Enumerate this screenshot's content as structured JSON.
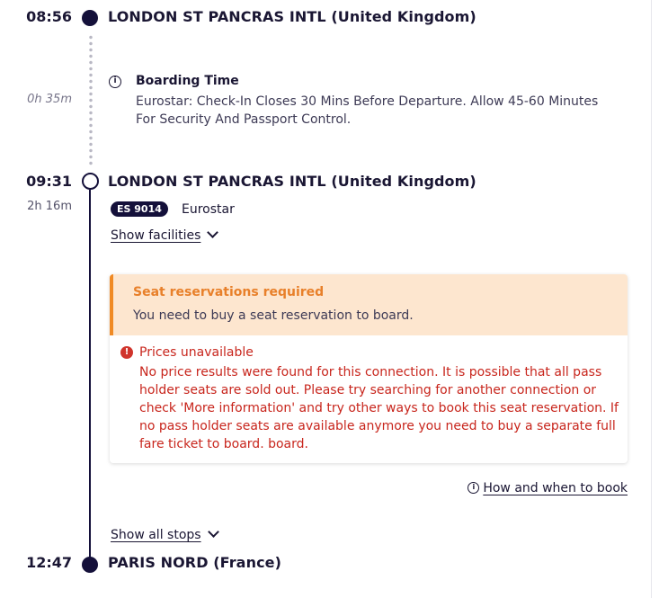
{
  "departure": {
    "time": "08:56",
    "station": "LONDON ST PANCRAS INTL (United Kingdom)"
  },
  "boarding": {
    "duration": "0h 35m",
    "title": "Boarding Time",
    "description": "Eurostar: Check-In Closes 30 Mins Before Departure. Allow 45-60 Minutes For Security And Passport Control."
  },
  "train_departure": {
    "time": "09:31",
    "station": "LONDON ST PANCRAS INTL (United Kingdom)",
    "duration": "2h 16m",
    "train_number": "ES 9014",
    "operator": "Eurostar",
    "show_facilities_label": "Show facilities"
  },
  "notice": {
    "warning_title": "Seat reservations required",
    "warning_text": "You need to buy a seat reservation to board.",
    "error_title": "Prices unavailable",
    "error_text": "No price results were found for this connection. It is possible that all pass holder seats are sold out. Please try searching for another connection or check 'More information' and try other ways to book this seat reservation. If no pass holder seats are available anymore you need to buy a separate full fare ticket to board. board.",
    "how_to_book_label": "How and when to book"
  },
  "show_all_stops_label": "Show all stops",
  "arrival": {
    "time": "12:47",
    "station": "PARIS NORD (France)"
  },
  "colors": {
    "accent_dark": "#14103a",
    "warning_bg": "#fde6cf",
    "warning_accent": "#f08a24",
    "error_red": "#c8261d"
  }
}
